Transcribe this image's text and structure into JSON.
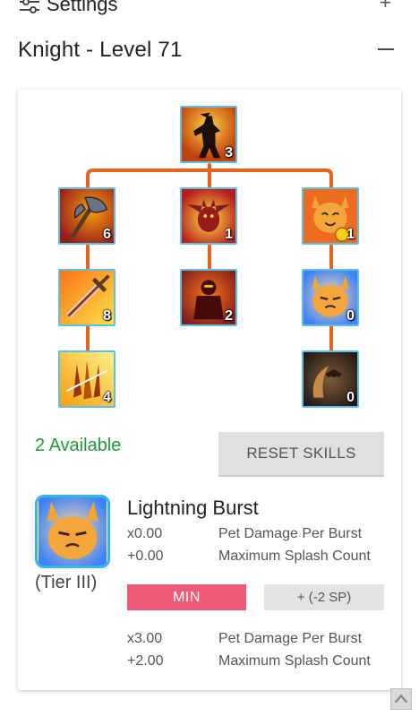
{
  "settings": {
    "title": "Settings",
    "toggle": "+"
  },
  "class_header": {
    "title": "Knight - Level 71"
  },
  "tree": {
    "skills": [
      {
        "id": "root",
        "level": "3",
        "icon": "silhouette-warrior-icon"
      },
      {
        "id": "axe",
        "level": "6",
        "icon": "flaming-axe-icon"
      },
      {
        "id": "demon",
        "level": "1",
        "icon": "winged-demon-icon"
      },
      {
        "id": "pet-cheer",
        "level": "1",
        "icon": "cheering-pet-icon"
      },
      {
        "id": "sword-strike",
        "level": "8",
        "icon": "flaming-sword-icon"
      },
      {
        "id": "shadow-knight",
        "level": "2",
        "icon": "shadow-knight-icon"
      },
      {
        "id": "lightning-pet",
        "level": "0",
        "icon": "lightning-pet-icon"
      },
      {
        "id": "blade-flurry",
        "level": "4",
        "icon": "blade-flurry-icon"
      },
      {
        "id": "horn-bat",
        "level": "0",
        "icon": "horn-bat-icon"
      }
    ]
  },
  "available": "2 Available",
  "reset_label": "RESET SKILLS",
  "detail": {
    "name": "Lightning Burst",
    "tier": "(Tier III)",
    "icon": "lightning-pet-icon",
    "current": [
      {
        "value": "x0.00",
        "label": "Pet Damage Per Burst"
      },
      {
        "value": "+0.00",
        "label": "Maximum Splash Count"
      }
    ],
    "min_label": "MIN",
    "plus_label": "+ (-2 SP)",
    "next": [
      {
        "value": "x3.00",
        "label": "Pet Damage Per Burst"
      },
      {
        "value": "+2.00",
        "label": "Maximum Splash Count"
      }
    ]
  },
  "colors": {
    "tree_line": "#e8641e",
    "icon_border": "#5bc0e8",
    "available": "#1f9b3a",
    "min_button": "#ee5a78"
  }
}
